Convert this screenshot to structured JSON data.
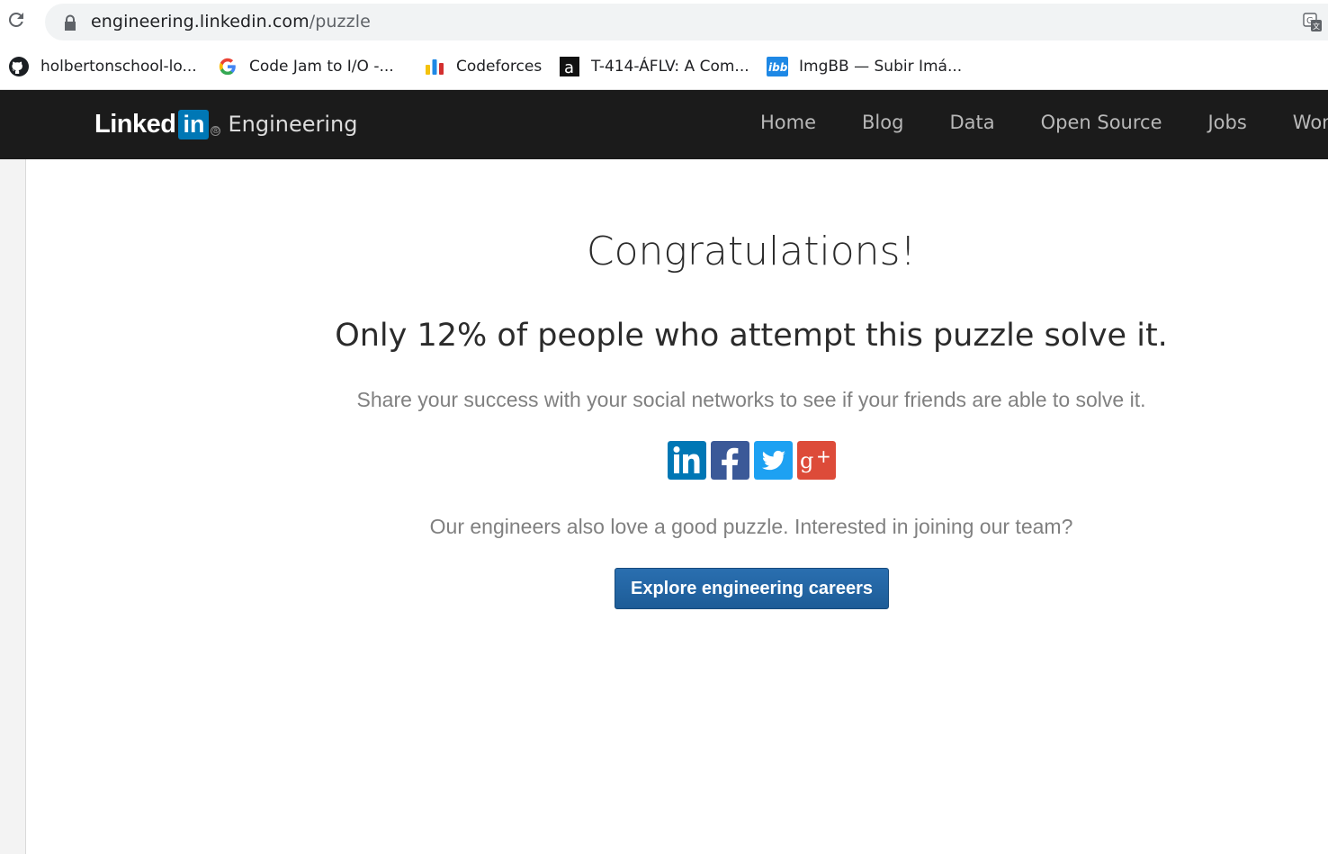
{
  "browser": {
    "url_host": "engineering.linkedin.com",
    "url_path": "/puzzle",
    "icons": {
      "reload": "reload-icon",
      "lock": "lock-icon",
      "translate": "translate-icon"
    }
  },
  "bookmarks": [
    {
      "label": "holbertonschool-lo...",
      "icon": "github-icon"
    },
    {
      "label": "Code Jam to I/O -...",
      "icon": "google-icon"
    },
    {
      "label": "Codeforces",
      "icon": "codeforces-icon"
    },
    {
      "label": "T-414-ÁFLV: A Com...",
      "icon": "a-icon"
    },
    {
      "label": "ImgBB — Subir Imá...",
      "icon": "ibb-icon"
    }
  ],
  "site": {
    "logo_text": "Linked",
    "logo_in": "in",
    "section": "Engineering",
    "nav": [
      "Home",
      "Blog",
      "Data",
      "Open Source",
      "Jobs",
      "Wome"
    ]
  },
  "main": {
    "title": "Congratulations!",
    "stat": "Only 12% of people who attempt this puzzle solve it.",
    "share_text": "Share your success with your social networks to see if your friends are able to solve it.",
    "social": [
      {
        "name": "linkedin",
        "icon": "linkedin-icon",
        "color": "#0077b5"
      },
      {
        "name": "facebook",
        "icon": "facebook-icon",
        "color": "#3b5998"
      },
      {
        "name": "twitter",
        "icon": "twitter-icon",
        "color": "#1da1f2"
      },
      {
        "name": "google-plus",
        "icon": "google-plus-icon",
        "color": "#dd4b39"
      }
    ],
    "join_text": "Our engineers also love a good puzzle. Interested in joining our team?",
    "cta_label": "Explore engineering careers"
  },
  "colors": {
    "nav_bg": "#1b1b1b",
    "cta_bg": "#2a6fb0",
    "linkedin_blue": "#0077b5"
  }
}
